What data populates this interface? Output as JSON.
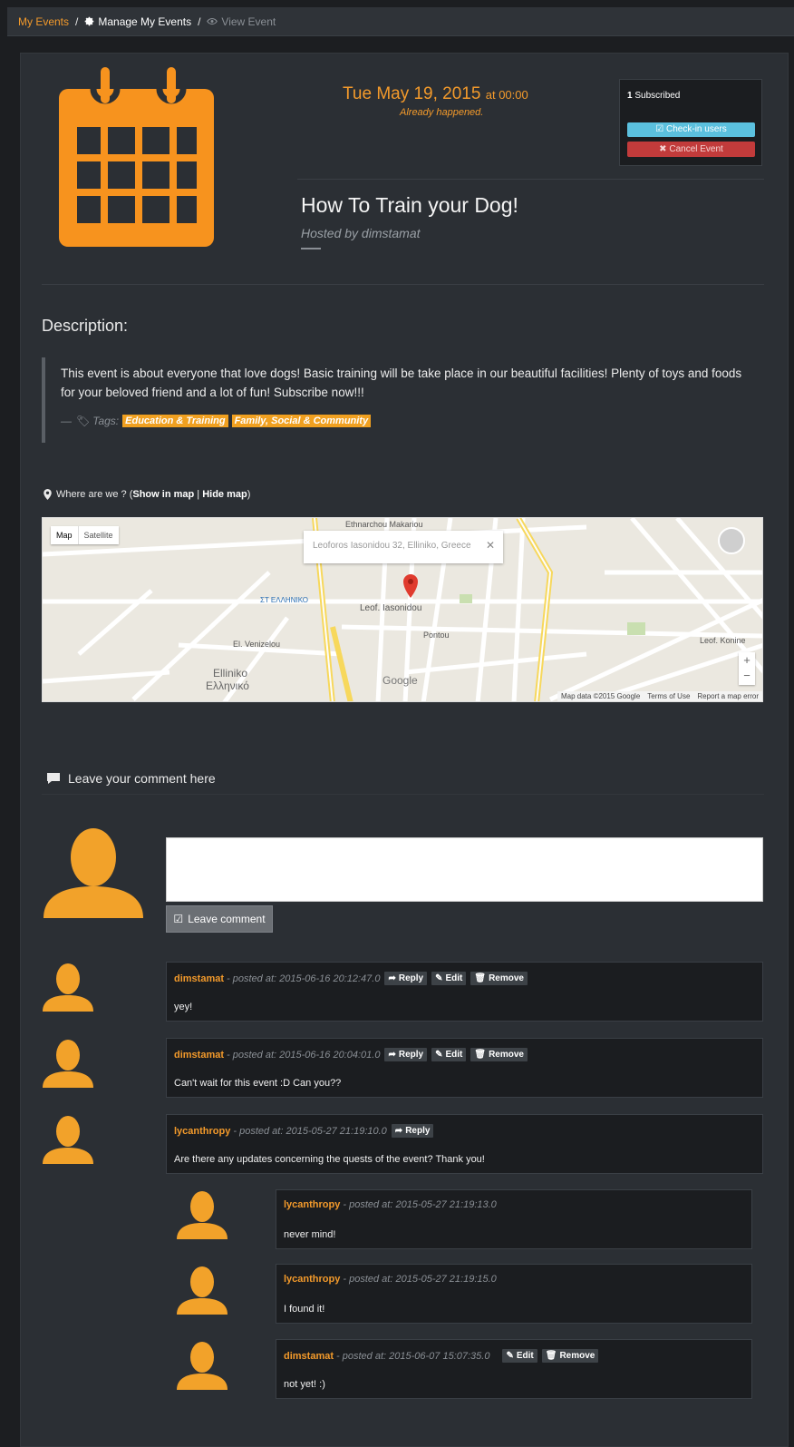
{
  "breadcrumb": {
    "my_events": "My Events",
    "sep": "/",
    "manage": "Manage My Events",
    "view": "View Event"
  },
  "event": {
    "date": "Tue May 19, 2015",
    "time": "at 00:00",
    "status": "Already happened.",
    "title": "How To Train your Dog!",
    "hosted_by": "Hosted by dimstamat",
    "subscribed_count": "1",
    "subscribed_label": "Subscribed",
    "checkin_label": "Check-in users",
    "cancel_label": "Cancel Event"
  },
  "description": {
    "heading": "Description:",
    "text": "This event is about everyone that love dogs! Basic training will be take place in our beautiful facilities! Plenty of toys and foods for your beloved friend and a lot of fun! Subscribe now!!!",
    "tags_prefix": "—",
    "tags_label": "Tags:",
    "tags": [
      "Education & Training",
      "Family, Social & Community"
    ]
  },
  "location": {
    "prefix": "Where are we ? (",
    "show": "Show in map",
    "divider": " | ",
    "hide": "Hide map",
    "suffix": ")",
    "address": "Leoforos Iasonidou 32, Elliniko, Greece",
    "map_tab": "Map",
    "satellite_tab": "Satellite",
    "map_data": "Map data ©2015 Google",
    "terms": "Terms of Use",
    "report": "Report a map error",
    "labels": [
      "Ethnarchou Makariou",
      "Leof. Iasonidou",
      "Pontou",
      "Elliniko",
      "Ελληνικό",
      "El. Venizelou",
      "ΣΤ ΕΛΛΗΝΙΚΟ",
      "Google",
      "Leof. Konine"
    ]
  },
  "comments": {
    "heading": "Leave your comment here",
    "leave_button": "Leave comment",
    "reply_label": "Reply",
    "edit_label": "Edit",
    "remove_label": "Remove",
    "posted_at": "- posted at:",
    "items": [
      {
        "user": "dimstamat",
        "time": "2015-06-16 20:12:47.0",
        "text": "yey!"
      },
      {
        "user": "dimstamat",
        "time": "2015-06-16 20:04:01.0",
        "text": "Can't wait for this event :D Can you??"
      },
      {
        "user": "lycanthropy",
        "time": "2015-05-27 21:19:10.0",
        "text": "Are there any updates concerning the quests of the event? Thank you!"
      }
    ],
    "replies": [
      {
        "user": "lycanthropy",
        "time": "2015-05-27 21:19:13.0",
        "text": "never mind!"
      },
      {
        "user": "lycanthropy",
        "time": "2015-05-27 21:19:15.0",
        "text": "I found it!"
      },
      {
        "user": "dimstamat",
        "time": "2015-06-07 15:07:35.0",
        "text": "not yet! :)"
      }
    ]
  },
  "colors": {
    "accent": "#f39a2b",
    "info": "#5bc0de",
    "danger": "#c23b3b",
    "panel": "#2b2f34"
  }
}
